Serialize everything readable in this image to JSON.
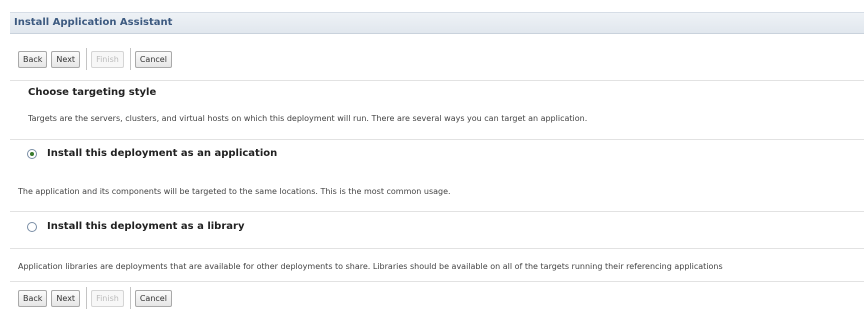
{
  "header": {
    "title": "Install Application Assistant"
  },
  "toolbar": {
    "back_label": "Back",
    "next_label": "Next",
    "finish_label": "Finish",
    "cancel_label": "Cancel"
  },
  "content": {
    "section_title": "Choose targeting style",
    "intro_text": "Targets are the servers, clusters, and virtual hosts on which this deployment will run. There are several ways you can target an application.",
    "options": [
      {
        "label": "Install this deployment as an application",
        "selected": true,
        "description": "The application and its components will be targeted to the same locations. This is the most common usage."
      },
      {
        "label": "Install this deployment as a library",
        "selected": false,
        "description": "Application libraries are deployments that are available for other deployments to share. Libraries should be available on all of the targets running their referencing applications"
      }
    ]
  }
}
